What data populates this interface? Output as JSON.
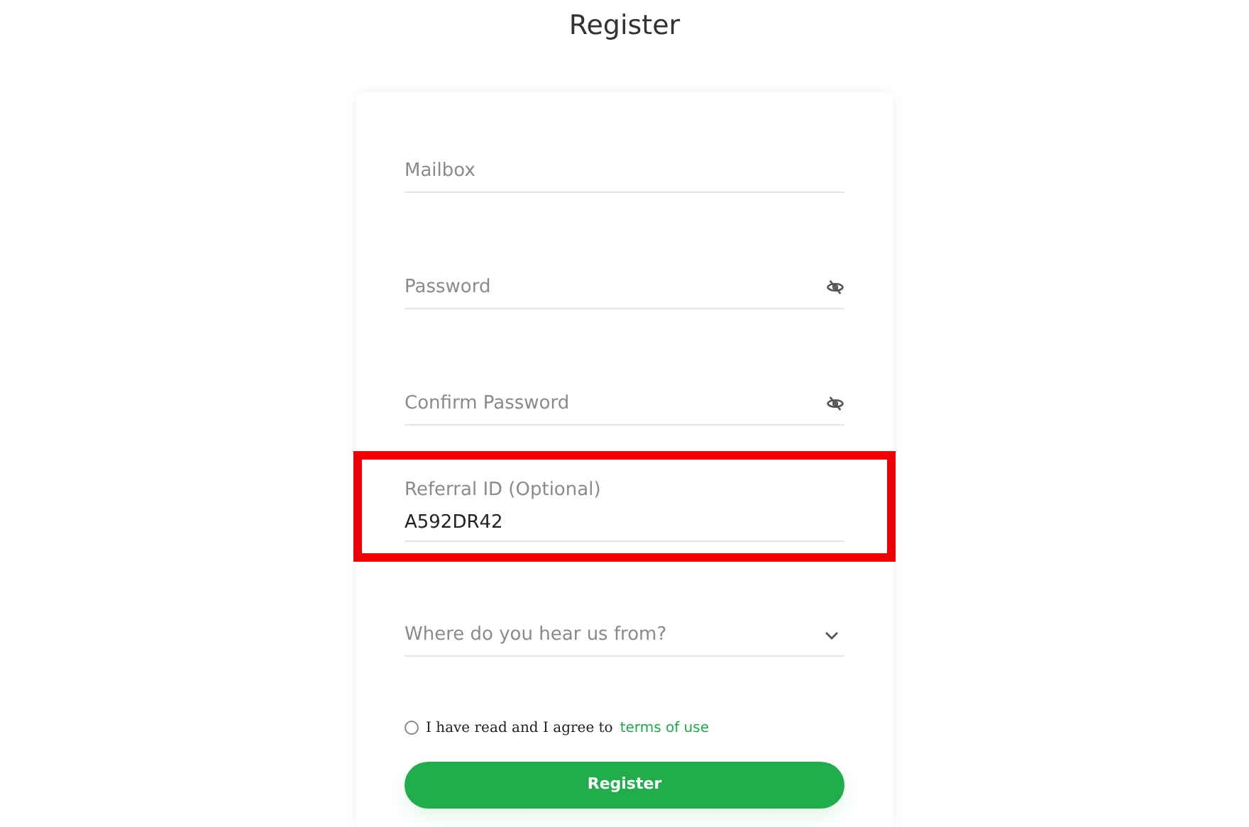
{
  "title": "Register",
  "fields": [
    {
      "kind": "text",
      "placeholder": "Mailbox",
      "highlighted": false
    },
    {
      "kind": "password",
      "placeholder": "Password",
      "highlighted": false
    },
    {
      "kind": "password",
      "placeholder": "Confirm Password",
      "highlighted": false
    },
    {
      "kind": "floating",
      "label": "Referral ID (Optional)",
      "value": "A592DR42",
      "highlighted": true
    },
    {
      "kind": "select",
      "placeholder": "Where do you hear us from?",
      "highlighted": false
    }
  ],
  "agreement": {
    "checked": false,
    "text": "I have read and I agree to",
    "link": "terms of use"
  },
  "submit": "Register"
}
